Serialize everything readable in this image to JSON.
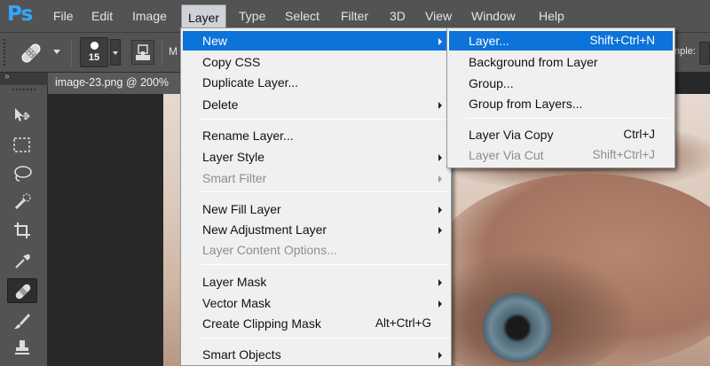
{
  "app": {
    "logo": "Ps"
  },
  "menubar": {
    "items": [
      "File",
      "Edit",
      "Image",
      "Layer",
      "Type",
      "Select",
      "Filter",
      "3D",
      "View",
      "Window",
      "Help"
    ],
    "active": "Layer"
  },
  "options_bar": {
    "tool_icon": "bandage-icon",
    "brush_size": "15",
    "mode_initial": "M",
    "sample_label": "nple:"
  },
  "tools": [
    {
      "name": "move-tool-icon"
    },
    {
      "name": "marquee-tool-icon"
    },
    {
      "name": "lasso-tool-icon"
    },
    {
      "name": "quick-selection-tool-icon"
    },
    {
      "name": "crop-tool-icon"
    },
    {
      "name": "eyedropper-tool-icon"
    },
    {
      "name": "healing-brush-tool-icon",
      "active": true
    },
    {
      "name": "brush-tool-icon"
    },
    {
      "name": "stamp-tool-icon"
    }
  ],
  "document": {
    "tab_title": "image-23.png @ 200%"
  },
  "layer_menu": {
    "items": [
      {
        "label": "New",
        "submenu": true,
        "highlighted": true
      },
      {
        "label": "Copy CSS"
      },
      {
        "label": "Duplicate Layer..."
      },
      {
        "label": "Delete",
        "submenu": true
      },
      {
        "label": "Rename Layer..."
      },
      {
        "label": "Layer Style",
        "submenu": true
      },
      {
        "label": "Smart Filter",
        "submenu": true,
        "disabled": true
      },
      {
        "label": "New Fill Layer",
        "submenu": true
      },
      {
        "label": "New Adjustment Layer",
        "submenu": true
      },
      {
        "label": "Layer Content Options...",
        "disabled": true
      },
      {
        "label": "Layer Mask",
        "submenu": true
      },
      {
        "label": "Vector Mask",
        "submenu": true
      },
      {
        "label": "Create Clipping Mask",
        "shortcut": "Alt+Ctrl+G"
      },
      {
        "label": "Smart Objects",
        "submenu": true
      }
    ]
  },
  "new_submenu": {
    "items": [
      {
        "label": "Layer...",
        "shortcut": "Shift+Ctrl+N",
        "highlighted": true
      },
      {
        "label": "Background from Layer"
      },
      {
        "label": "Group..."
      },
      {
        "label": "Group from Layers..."
      },
      {
        "label": "Layer Via Copy",
        "shortcut": "Ctrl+J"
      },
      {
        "label": "Layer Via Cut",
        "shortcut": "Shift+Ctrl+J",
        "disabled": true
      }
    ]
  },
  "colors": {
    "menubar_bg": "#535353",
    "menu_bg": "#f0f0f0",
    "highlight": "#0b73d9",
    "logo": "#31a8ff",
    "disabled_text": "#8d8d8d"
  }
}
